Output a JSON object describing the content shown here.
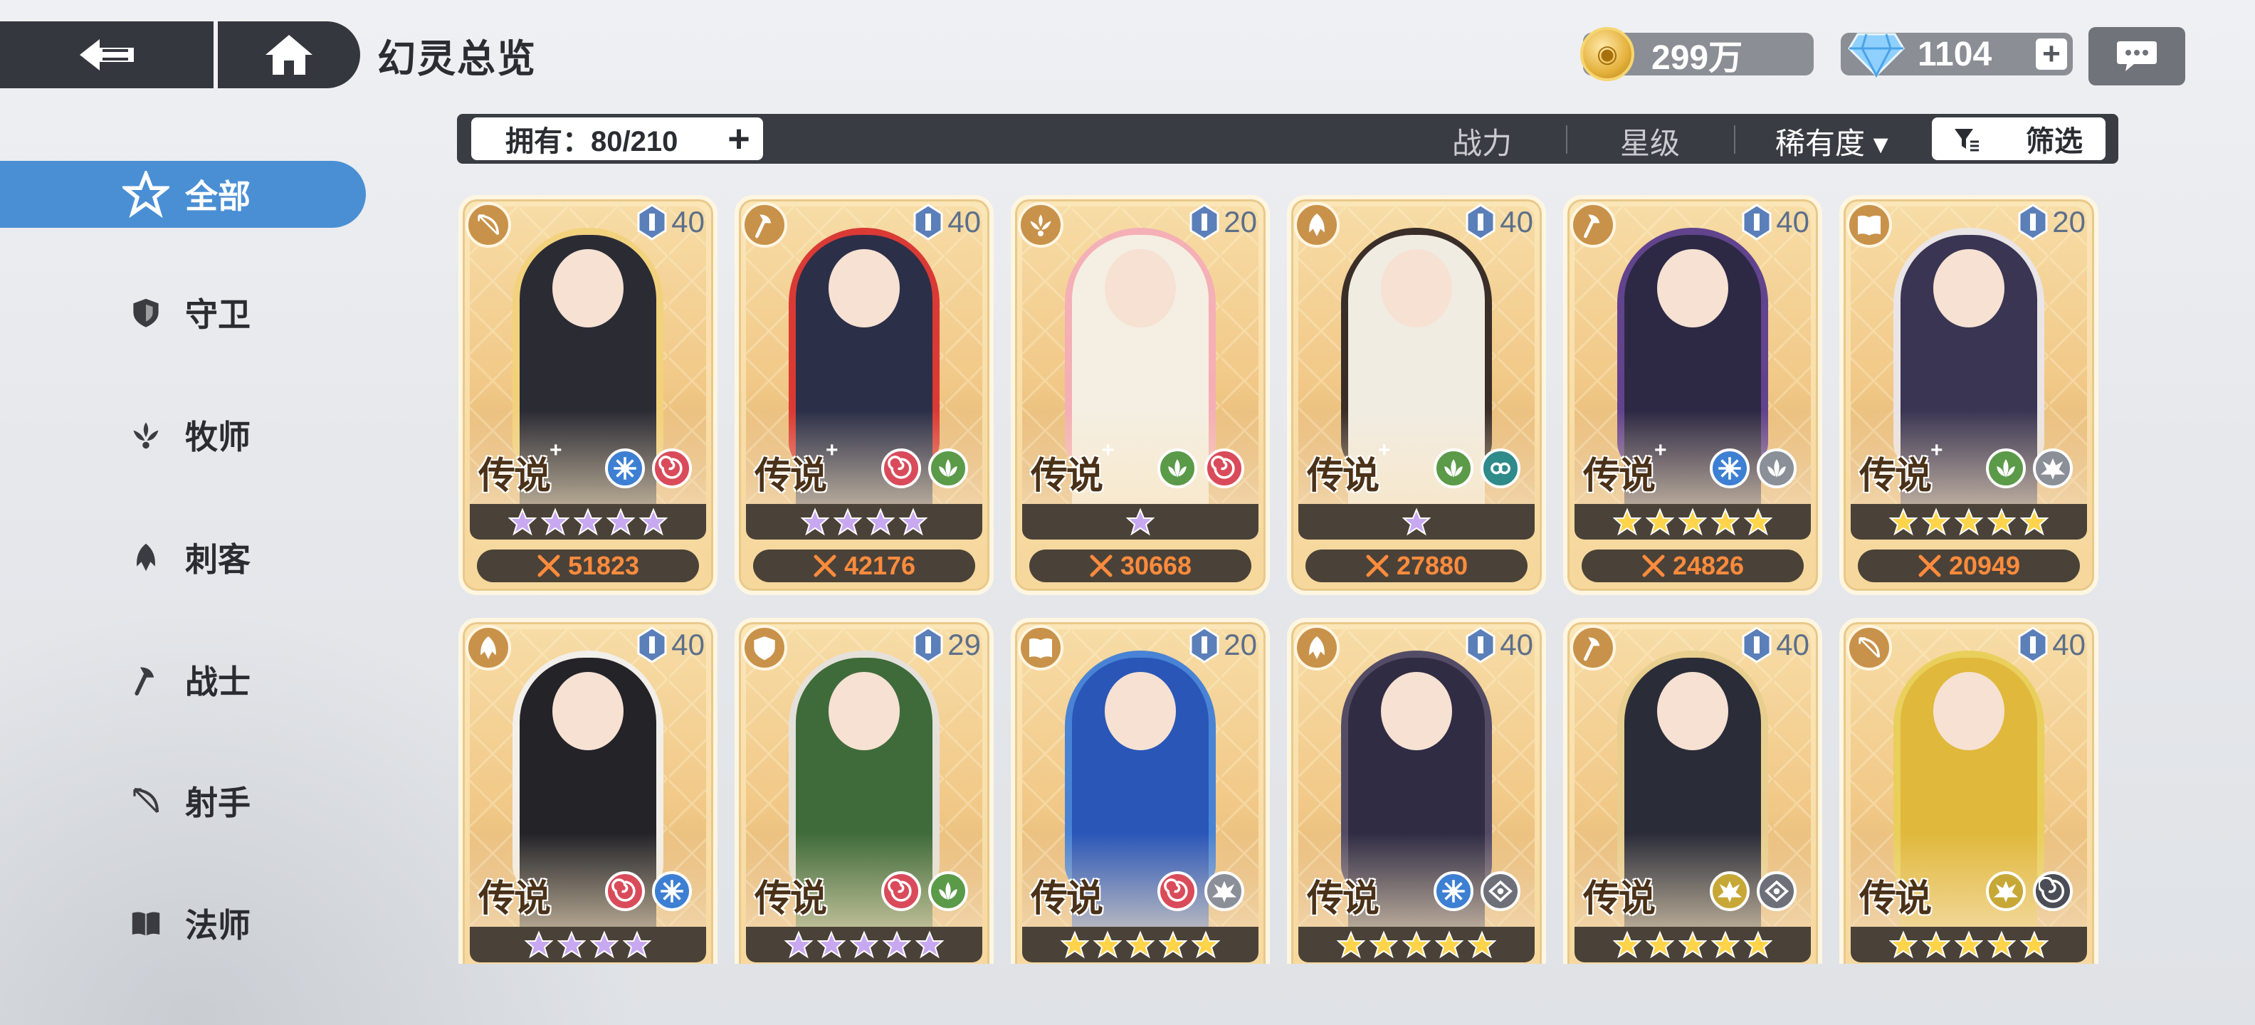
{
  "header": {
    "title": "幻灵总览",
    "gold": "299万",
    "gems": "1104"
  },
  "filter": {
    "owned": "拥有：80/210",
    "sort_power": "战力",
    "sort_star": "星级",
    "sort_rarity": "稀有度 ▾",
    "filter_label": "筛选"
  },
  "sidebar": {
    "items": [
      {
        "label": "全部",
        "icon": "all-star-icon",
        "active": true
      },
      {
        "label": "守卫",
        "icon": "shield-icon"
      },
      {
        "label": "牧师",
        "icon": "priest-icon"
      },
      {
        "label": "刺客",
        "icon": "assassin-icon"
      },
      {
        "label": "战士",
        "icon": "axe-icon"
      },
      {
        "label": "射手",
        "icon": "bow-icon"
      },
      {
        "label": "法师",
        "icon": "book-icon"
      }
    ]
  },
  "cards": [
    {
      "class": "bow",
      "level": "40",
      "rarity": "传说",
      "plus": true,
      "elements": [
        "frost",
        "chaos"
      ],
      "stars": 5,
      "star_color": "purple",
      "power": "51823",
      "hair": "#f1d27a",
      "outfit": "#2b2b34"
    },
    {
      "class": "axe",
      "level": "40",
      "rarity": "传说",
      "plus": true,
      "elements": [
        "chaos",
        "nature"
      ],
      "stars": 4,
      "star_color": "purple",
      "power": "42176",
      "hair": "#d8322f",
      "outfit": "#2c2f48"
    },
    {
      "class": "priest",
      "level": "20",
      "rarity": "传说",
      "plus": true,
      "elements": [
        "nature",
        "chaos"
      ],
      "stars": 1,
      "star_color": "purple",
      "power": "30668",
      "hair": "#f3aeb7",
      "outfit": "#f4efe2"
    },
    {
      "class": "assassin",
      "level": "40",
      "rarity": "传说",
      "plus": true,
      "elements": [
        "nature",
        "void"
      ],
      "stars": 1,
      "star_color": "purple",
      "power": "27880",
      "hair": "#2f2522",
      "outfit": "#f1ece2"
    },
    {
      "class": "axe",
      "level": "40",
      "rarity": "传说",
      "plus": true,
      "elements": [
        "frost",
        "nature-gray"
      ],
      "stars": 5,
      "star_color": "gold",
      "power": "24826",
      "hair": "#5a3b8c",
      "outfit": "#2d2944"
    },
    {
      "class": "book",
      "level": "20",
      "rarity": "传说",
      "plus": true,
      "elements": [
        "nature",
        "light"
      ],
      "stars": 5,
      "star_color": "gold",
      "power": "20949",
      "hair": "#e9e6ea",
      "outfit": "#3a3553"
    },
    {
      "class": "assassin",
      "level": "40",
      "rarity": "传说",
      "plus": false,
      "elements": [
        "chaos",
        "frost"
      ],
      "stars": 4,
      "star_color": "purple",
      "power": "",
      "hair": "#f1f0ee",
      "outfit": "#232328"
    },
    {
      "class": "shield",
      "level": "29",
      "rarity": "传说",
      "plus": false,
      "elements": [
        "chaos",
        "nature"
      ],
      "stars": 5,
      "star_color": "purple",
      "power": "",
      "hair": "#e4e2dd",
      "outfit": "#3f6b3a"
    },
    {
      "class": "book",
      "level": "20",
      "rarity": "传说",
      "plus": false,
      "elements": [
        "chaos",
        "light"
      ],
      "stars": 5,
      "star_color": "gold",
      "power": "",
      "hair": "#3f7ed8",
      "outfit": "#2a56b8"
    },
    {
      "class": "assassin",
      "level": "40",
      "rarity": "传说",
      "plus": false,
      "elements": [
        "frost",
        "eye"
      ],
      "stars": 5,
      "star_color": "gold",
      "power": "",
      "hair": "#4b4563",
      "outfit": "#2f2c44"
    },
    {
      "class": "axe",
      "level": "40",
      "rarity": "传说",
      "plus": false,
      "elements": [
        "light-gold",
        "eye"
      ],
      "stars": 5,
      "star_color": "gold",
      "power": "",
      "hair": "#e7cf8e",
      "outfit": "#2a2c38"
    },
    {
      "class": "bow",
      "level": "40",
      "rarity": "传说",
      "plus": false,
      "elements": [
        "light-gold",
        "vortex"
      ],
      "stars": 5,
      "star_color": "gold",
      "power": "",
      "hair": "#e8cf58",
      "outfit": "#e0b83c"
    }
  ],
  "colors": {
    "accent": "#4a8fd4",
    "bar": "#3a3c43",
    "power_text": "#ff8b3d",
    "star_purple": "#c8a8f0",
    "star_gold": "#ffd44a"
  }
}
